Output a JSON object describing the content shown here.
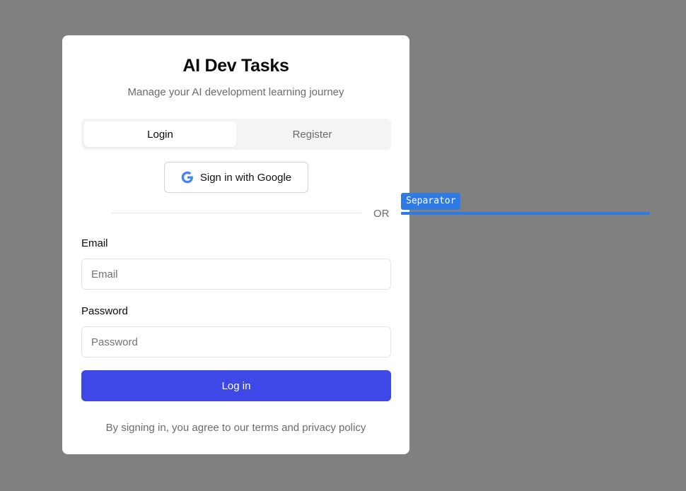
{
  "app": {
    "title": "AI Dev Tasks",
    "subtitle": "Manage your AI development learning journey"
  },
  "tabs": [
    {
      "label": "Login",
      "active": true
    },
    {
      "label": "Register",
      "active": false
    }
  ],
  "google_button": {
    "label": "Sign in with Google",
    "icon": "google-icon"
  },
  "separator": {
    "text": "OR"
  },
  "form": {
    "email": {
      "label": "Email",
      "placeholder": "Email",
      "value": ""
    },
    "password": {
      "label": "Password",
      "placeholder": "Password",
      "value": ""
    },
    "submit_label": "Log in"
  },
  "footer": {
    "terms": "By signing in, you agree to our terms and privacy policy"
  },
  "annotation": {
    "label": "Separator"
  },
  "colors": {
    "background": "#808080",
    "primary": "#3d48e6",
    "annotation": "#2f7ae5"
  }
}
